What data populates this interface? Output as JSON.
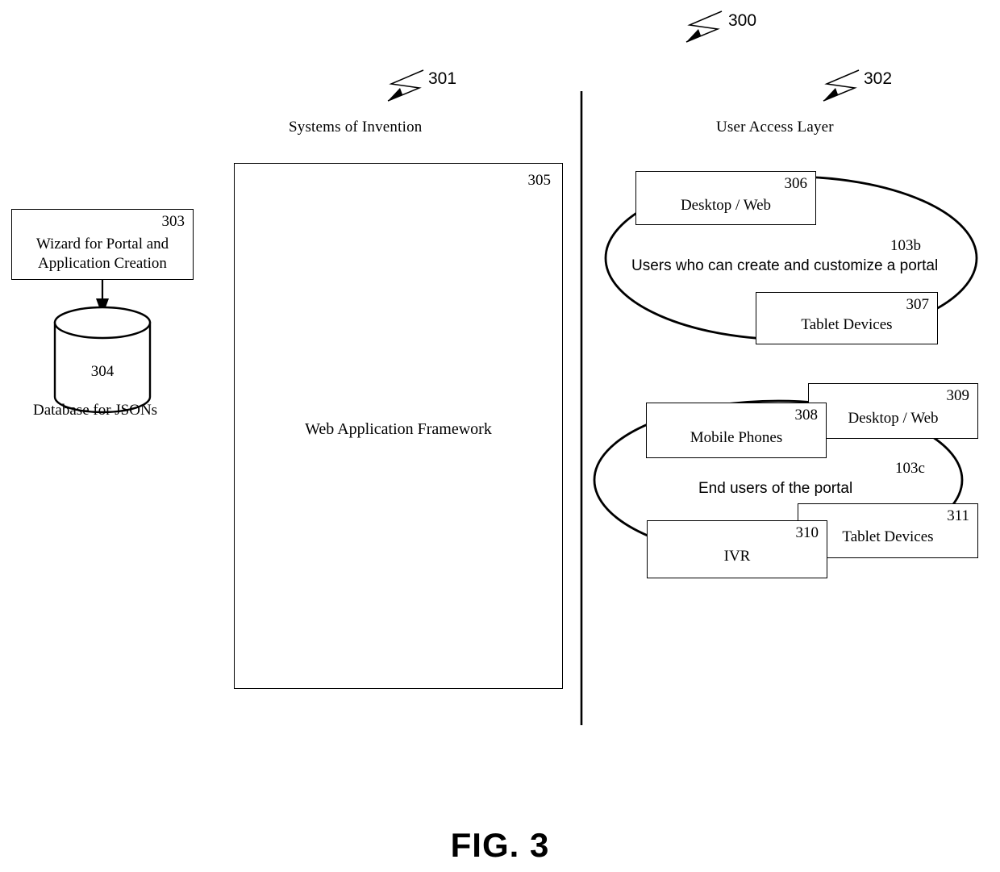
{
  "figure": {
    "caption": "FIG. 3",
    "overall_ref": "300"
  },
  "sections": {
    "left": {
      "title": "Systems of Invention",
      "ref": "301"
    },
    "right": {
      "title": "User Access Layer",
      "ref": "302"
    }
  },
  "left_column": {
    "wizard_box": {
      "ref": "303",
      "line1": "Wizard for Portal and",
      "line2": "Application Creation"
    },
    "database": {
      "ref": "304",
      "caption": "Database for JSONs"
    },
    "framework_box": {
      "ref": "305",
      "label": "Web Application Framework"
    }
  },
  "user_groups": [
    {
      "ref": "103b",
      "caption": "Users who can create and customize a portal",
      "nodes": [
        {
          "ref": "306",
          "label": "Desktop / Web"
        },
        {
          "ref": "307",
          "label": "Tablet Devices"
        }
      ]
    },
    {
      "ref": "103c",
      "caption": "End users of the portal",
      "nodes": [
        {
          "ref": "308",
          "label": "Mobile Phones"
        },
        {
          "ref": "309",
          "label": "Desktop / Web"
        },
        {
          "ref": "310",
          "label": "IVR"
        },
        {
          "ref": "311",
          "label": "Tablet Devices"
        }
      ]
    }
  ],
  "icons": {
    "lead_line": "lightning-lead-line-icon",
    "arrow": "down-arrow-icon",
    "cylinder": "database-cylinder-icon",
    "ellipse": "grouping-ellipse-icon",
    "divider": "vertical-divider-icon"
  }
}
